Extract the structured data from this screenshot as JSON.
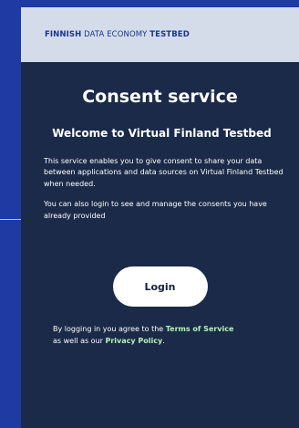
{
  "header": {
    "brand_part1": "FINNISH",
    "brand_part2": " DATA ECONOMY ",
    "brand_part3": "TESTBED"
  },
  "main": {
    "title": "Consent service",
    "subtitle": "Welcome to Virtual Finland Testbed",
    "paragraph1": "This service enables you to give consent to share your data between applications and data sources on Virtual Finland Testbed when needed.",
    "paragraph2": "You can also login to see and manage the consents you have already provided",
    "login_label": "Login"
  },
  "legal": {
    "text1": "By logging in you agree to the ",
    "terms_link": "Terms of Service",
    "text2": "as well as our ",
    "privacy_link": "Privacy Policy",
    "text3": "."
  },
  "colors": {
    "page_background": "#1f3aa3",
    "card_background": "#1b2a48",
    "header_background": "#d4dcea",
    "brand_text": "#1a3693",
    "link": "#b6f0b6"
  }
}
